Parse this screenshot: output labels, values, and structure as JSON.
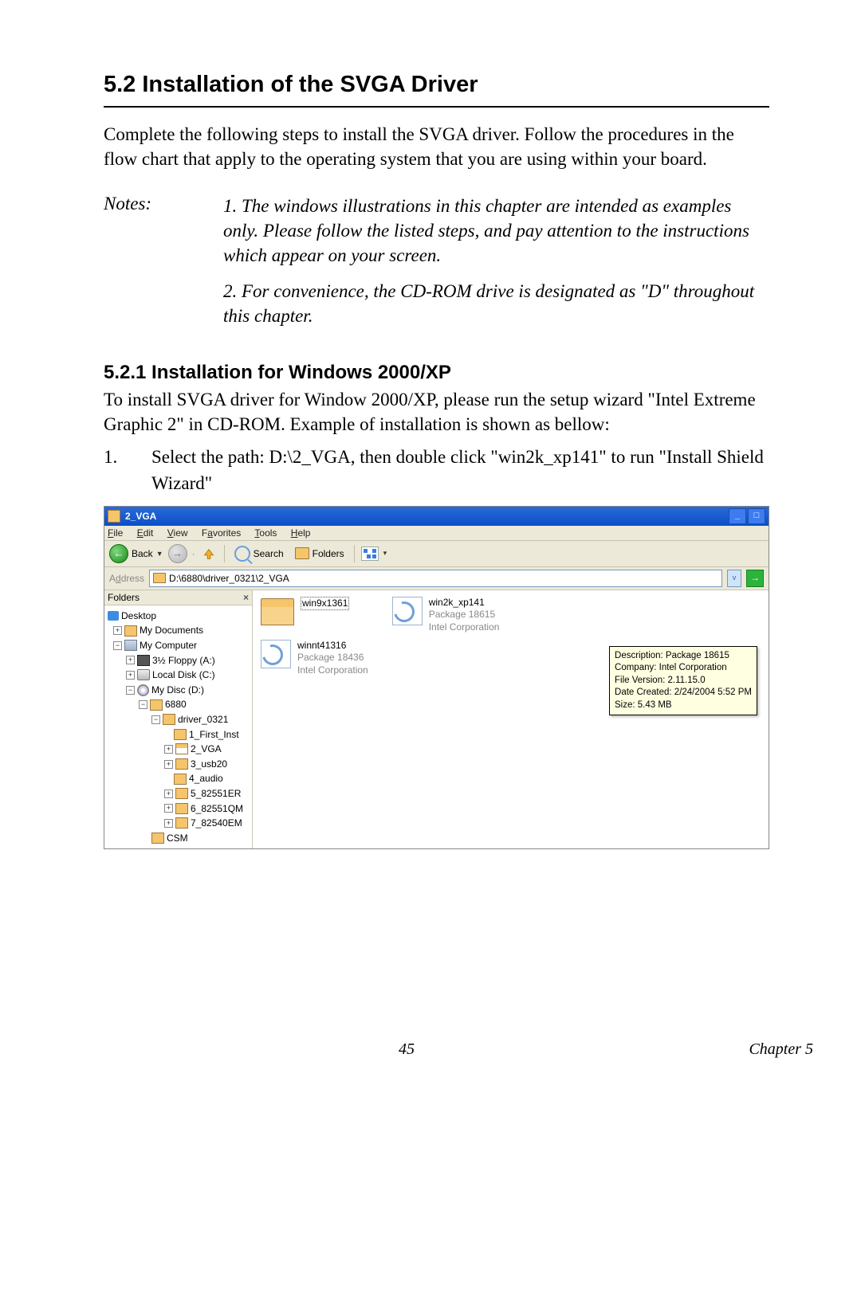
{
  "heading": "5.2  Installation of the SVGA Driver",
  "intro": "Complete the following steps to install the SVGA driver. Follow the procedures in the flow chart that apply to the operating system that you are using within your board.",
  "notes_label": "Notes:",
  "note1": "1.  The windows illustrations in this chapter are intended as examples only. Please follow the listed steps, and pay attention to the instructions which appear on your screen.",
  "note2": "2.  For convenience, the CD-ROM drive is designated as \"D\" throughout this chapter.",
  "sub_heading": "5.2.1 Installation for Windows 2000/XP",
  "sub_para": "To install SVGA driver for Window 2000/XP, please run the setup wizard \"Intel Extreme Graphic 2\" in CD-ROM. Example of installation is shown as bellow:",
  "step1_num": "1.",
  "step1_text": "Select the path: D:\\2_VGA, then double click \"win2k_xp141\" to run \"Install Shield Wizard\"",
  "win": {
    "title": "2_VGA",
    "menu": {
      "file": "File",
      "edit": "Edit",
      "view": "View",
      "fav": "Favorites",
      "tools": "Tools",
      "help": "Help"
    },
    "toolbar": {
      "back": "Back",
      "search": "Search",
      "folders": "Folders"
    },
    "address_label": "Address",
    "address_value": "D:\\6880\\driver_0321\\2_VGA",
    "folders_title": "Folders",
    "tree": {
      "desktop": "Desktop",
      "mydocs": "My Documents",
      "mycomp": "My Computer",
      "floppy": "3½ Floppy (A:)",
      "localc": "Local Disk (C:)",
      "mydisc": "My Disc (D:)",
      "d6880": "6880",
      "driver": "driver_0321",
      "first": "1_First_Inst",
      "vga": "2_VGA",
      "usb": "3_usb20",
      "audio": "4_audio",
      "er": "5_82551ER",
      "qm": "6_82551QM",
      "em": "7_82540EM",
      "csm": "CSM"
    },
    "files": {
      "win9x": "win9x1361",
      "winnt": "winnt41316",
      "winnt_sub1": "Package 18436",
      "winnt_sub2": "Intel Corporation",
      "win2k": "win2k_xp141",
      "win2k_sub1": "Package 18615",
      "win2k_sub2": "Intel Corporation"
    },
    "tooltip": {
      "l1": "Description: Package 18615",
      "l2": "Company: Intel Corporation",
      "l3": "File Version: 2.11.15.0",
      "l4": "Date Created: 2/24/2004 5:52 PM",
      "l5": "Size: 5.43 MB"
    }
  },
  "footer_page": "45",
  "footer_chapter": "Chapter 5"
}
